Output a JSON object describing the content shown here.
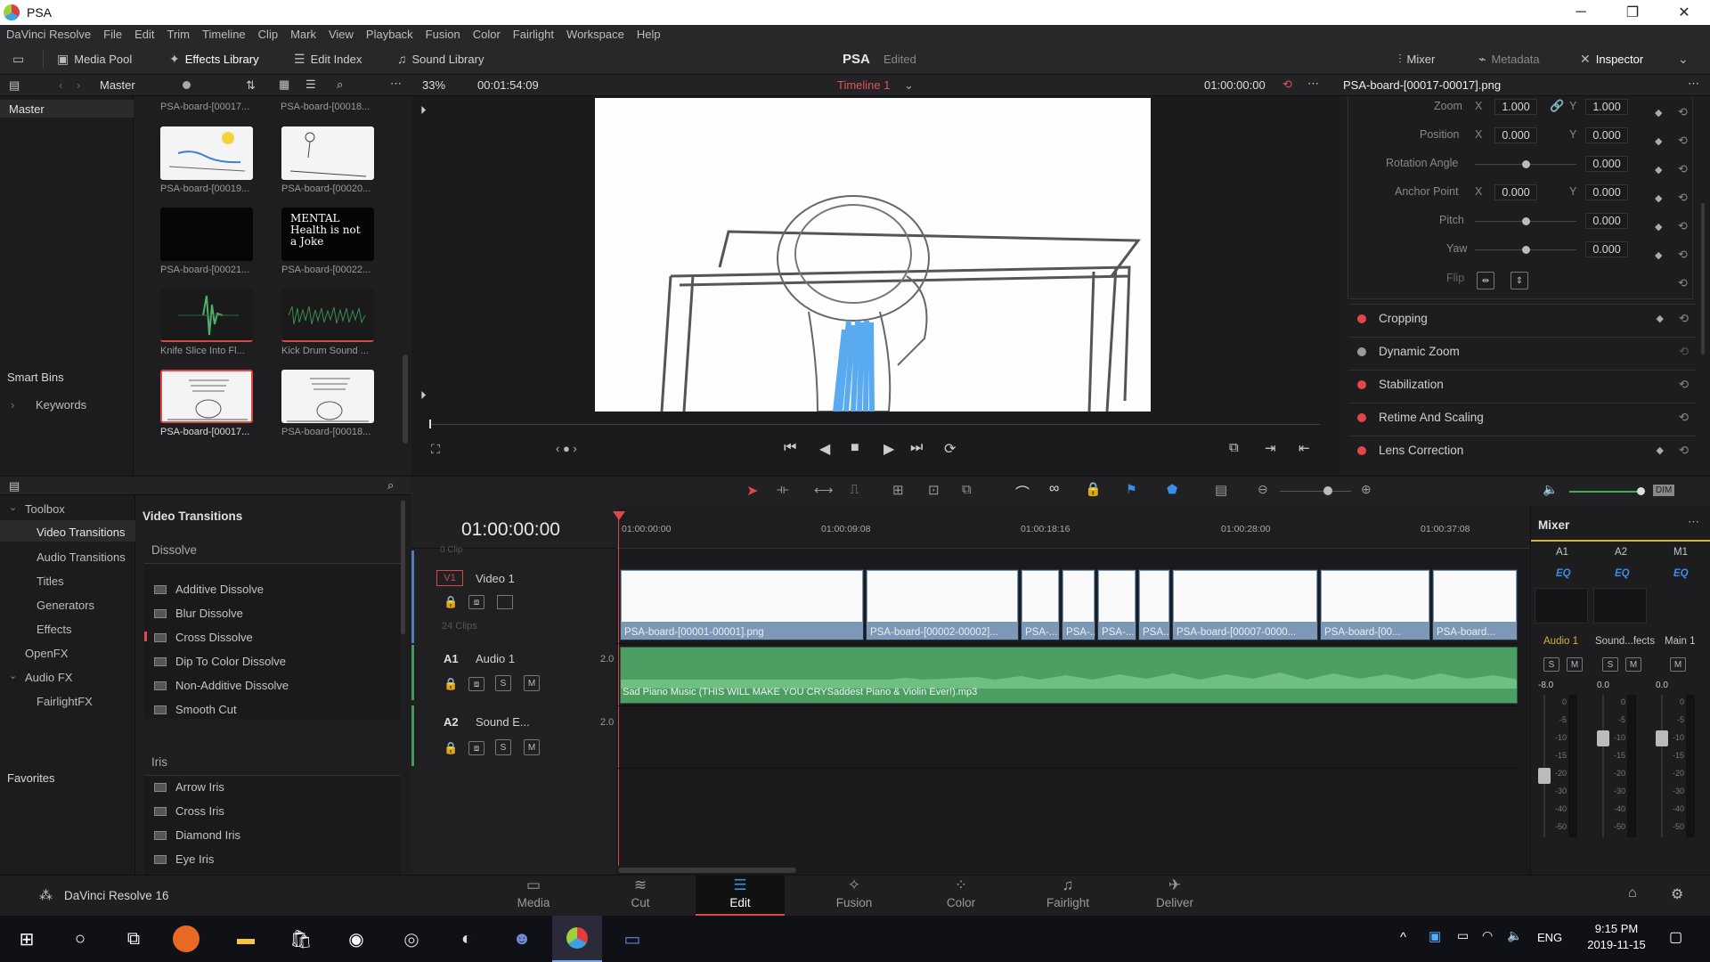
{
  "window": {
    "title": "PSA",
    "minimize": "─",
    "maximize": "❐",
    "close": "✕"
  },
  "menu": [
    "DaVinci Resolve",
    "File",
    "Edit",
    "Trim",
    "Timeline",
    "Clip",
    "Mark",
    "View",
    "Playback",
    "Fusion",
    "Color",
    "Fairlight",
    "Workspace",
    "Help"
  ],
  "toolbar": {
    "media_pool": "Media Pool",
    "effects_library": "Effects Library",
    "edit_index": "Edit Index",
    "sound_library": "Sound Library",
    "project": "PSA",
    "status": "Edited",
    "mixer": "Mixer",
    "metadata": "Metadata",
    "inspector": "Inspector"
  },
  "subbar": {
    "bin": "Master",
    "zoom": "33%",
    "duration": "00:01:54:09",
    "timeline": "Timeline 1",
    "timecode": "01:00:00:00",
    "clip_name": "PSA-board-[00017-00017].png"
  },
  "media_pool": {
    "root": "Master",
    "smart_bins": "Smart Bins",
    "keywords": "Keywords",
    "top_captions": [
      "PSA-board-[00017...",
      "PSA-board-[00018..."
    ],
    "clips": [
      {
        "caption": "PSA-board-[00019..."
      },
      {
        "caption": "PSA-board-[00020..."
      },
      {
        "caption": "PSA-board-[00021..."
      },
      {
        "caption": "PSA-board-[00022..."
      },
      {
        "caption": "Knife Slice Into Fl..."
      },
      {
        "caption": "Kick Drum Sound ..."
      },
      {
        "caption": "PSA-board-[00017..."
      },
      {
        "caption": "PSA-board-[00018..."
      }
    ],
    "mental_text": "MENTAL Health is not a Joke"
  },
  "effects": {
    "tree": [
      "Toolbox",
      "Video Transitions",
      "Audio Transitions",
      "Titles",
      "Generators",
      "Effects",
      "OpenFX",
      "Audio FX",
      "FairlightFX"
    ],
    "favorites": "Favorites",
    "heading": "Video Transitions",
    "dissolve_heading": "Dissolve",
    "dissolve": [
      "Additive Dissolve",
      "Blur Dissolve",
      "Cross Dissolve",
      "Dip To Color Dissolve",
      "Non-Additive Dissolve",
      "Smooth Cut"
    ],
    "iris_heading": "Iris",
    "iris": [
      "Arrow Iris",
      "Cross Iris",
      "Diamond Iris",
      "Eye Iris"
    ]
  },
  "inspector": {
    "zoom": {
      "label": "Zoom",
      "x": "1.000",
      "y": "1.000"
    },
    "position": {
      "label": "Position",
      "x": "0.000",
      "y": "0.000"
    },
    "rotation": {
      "label": "Rotation Angle",
      "value": "0.000"
    },
    "anchor": {
      "label": "Anchor Point",
      "x": "0.000",
      "y": "0.000"
    },
    "pitch": {
      "label": "Pitch",
      "value": "0.000"
    },
    "yaw": {
      "label": "Yaw",
      "value": "0.000"
    },
    "flip": "Flip",
    "x": "X",
    "y": "Y",
    "sections": [
      "Cropping",
      "Dynamic Zoom",
      "Stabilization",
      "Retime And Scaling",
      "Lens Correction"
    ]
  },
  "timeline": {
    "timecode": "01:00:00:00",
    "ruler": [
      "01:00:00:00",
      "01:00:09:08",
      "01:00:18:16",
      "01:00:28:00",
      "01:00:37:08"
    ],
    "prev_clips": "0 Clip",
    "v1": {
      "id": "V1",
      "name": "Video 1",
      "clips_count": "24 Clips"
    },
    "a1": {
      "id": "A1",
      "name": "Audio 1",
      "level": "2.0",
      "clip": "Sad Piano Music (THIS WILL MAKE YOU CRYSaddest Piano & Violin Ever!).mp3"
    },
    "a2": {
      "id": "A2",
      "name": "Sound E...",
      "level": "2.0"
    },
    "solo": "S",
    "mute": "M",
    "video_clips": [
      "PSA-board-[00001-00001].png",
      "PSA-board-[00002-00002]...",
      "PSA-...",
      "PSA-...",
      "PSA-...",
      "PSA...",
      "PSA-board-[00007-0000...",
      "PSA-board-[00...",
      "PSA-board..."
    ]
  },
  "mixer": {
    "title": "Mixer",
    "channels": [
      "A1",
      "A2",
      "M1"
    ],
    "eq": "EQ",
    "names": [
      "Audio 1",
      "Sound...fects",
      "Main 1"
    ],
    "levels": [
      "-8.0",
      "0.0",
      "0.0"
    ],
    "dim": "DIM",
    "scale": [
      "0",
      "-5",
      "-10",
      "-15",
      "-20",
      "-30",
      "-40",
      "-50"
    ]
  },
  "pages": [
    "Media",
    "Cut",
    "Edit",
    "Fusion",
    "Color",
    "Fairlight",
    "Deliver"
  ],
  "app_name": "DaVinci Resolve 16",
  "taskbar": {
    "lang": "ENG",
    "time": "9:15 PM",
    "date": "2019-11-15"
  },
  "colors": {
    "accent_red": "#e04848",
    "clip_blue": "#7d98b6",
    "audio_green": "#4d9e63"
  }
}
